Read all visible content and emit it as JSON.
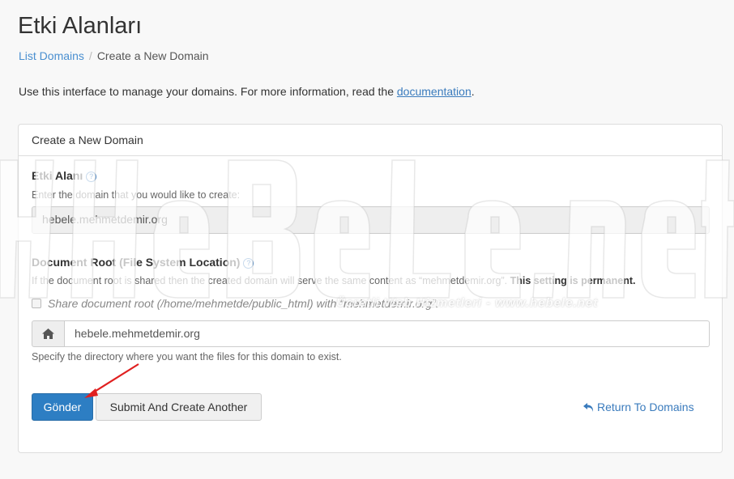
{
  "header": {
    "title": "Etki Alanları"
  },
  "breadcrumb": {
    "items": [
      {
        "label": "List Domains"
      },
      {
        "label": "Create a New Domain"
      }
    ],
    "separator": "/"
  },
  "intro": {
    "text": "Use this interface to manage your domains. For more information, read the ",
    "link": "documentation",
    "end": "."
  },
  "panel": {
    "heading": "Create a New Domain",
    "domain": {
      "label": "Etki Alanı",
      "help": "Enter the domain that you would like to create:",
      "value": "hebele.mehmetdemir.org"
    },
    "docroot": {
      "label": "Document Root (File System Location)",
      "help": "If the document root is shared then the created domain will serve the same content as “mehmetdemir.org”.",
      "help_bold": "This setting is permanent.",
      "share_checkbox": "Share document root (/home/mehmetde/public_html) with “mehmetdemir.org”.",
      "value": "hebele.mehmetdemir.org",
      "hint": "Specify the directory where you want the files for this domain to exist.",
      "addon_icon": "home-icon"
    },
    "actions": {
      "submit": "Gönder",
      "submit_another": "Submit And Create Another",
      "return": "Return To Domains"
    }
  },
  "watermark": {
    "brand": "HHeBeLe.net",
    "tagline": "Ücretli Web Hizmetleri - www.hebele.net"
  },
  "colors": {
    "primary": "#2d7ec3",
    "link": "#3a7bbd",
    "arrow": "#e02020"
  }
}
